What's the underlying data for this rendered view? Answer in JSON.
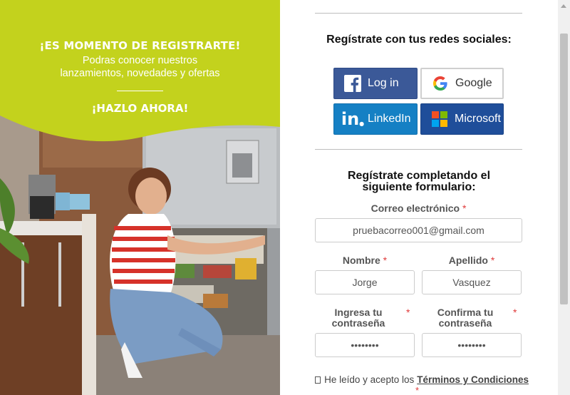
{
  "promo": {
    "title": "¡ES MOMENTO DE REGISTRARTE!",
    "subtitle": "Podras conocer nuestros lanzamientos, novedades y ofertas",
    "cta": "¡HAZLO AHORA!",
    "accent_color": "#c3d21d"
  },
  "social": {
    "heading": "Regístrate con tus redes sociales:",
    "facebook_label": "Log in",
    "google_label": "Google",
    "linkedin_label": "LinkedIn",
    "microsoft_label": "Microsoft"
  },
  "form": {
    "heading": "Regístrate completando el siguiente formulario:",
    "email_label": "Correo electrónico",
    "email_value": "pruebacorreo001@gmail.com",
    "first_name_label": "Nombre",
    "first_name_value": "Jorge",
    "last_name_label": "Apellido",
    "last_name_value": "Vasquez",
    "password_label": "Ingresa tu contraseña",
    "password_value": "••••••••",
    "confirm_label": "Confirma tu contraseña",
    "confirm_value": "••••••••",
    "required_mark": "*"
  },
  "terms": {
    "text": "He leído y acepto los",
    "link": "Términos y Condiciones"
  }
}
